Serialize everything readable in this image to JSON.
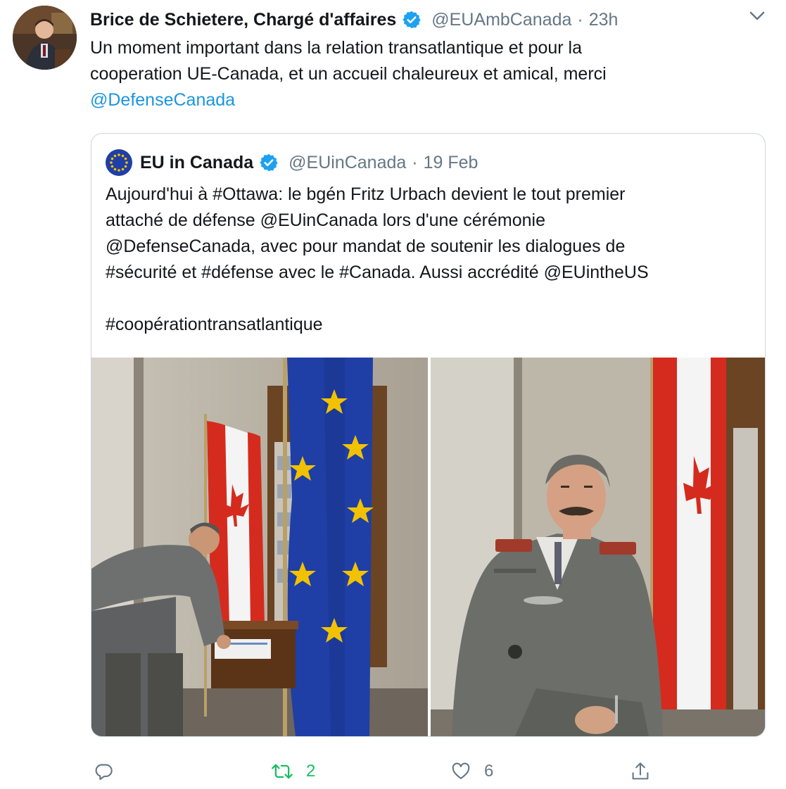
{
  "tweet": {
    "author_name": "Brice de Schietere, Chargé d'affaires",
    "handle": "@EUAmbCanada",
    "separator": "·",
    "time": "23h",
    "text_lines": [
      "Un moment important dans la relation transatlantique et pour la",
      "cooperation UE-Canada, et un accueil chaleureux et amical, merci"
    ],
    "mention": "@DefenseCanada"
  },
  "quote": {
    "author_name": "EU in Canada",
    "handle": "@EUinCanada",
    "separator": "·",
    "date": "19 Feb",
    "text_lines": [
      "Aujourd'hui à #Ottawa: le bgén Fritz Urbach devient le tout premier",
      "attaché de défense @EUinCanada lors d'une cérémonie",
      "@DefenseCanada, avec pour mandat de soutenir les dialogues de",
      "#sécurité et #défense avec le #Canada. Aussi accrédité @EUintheUS",
      "",
      "#coopérationtransatlantique"
    ]
  },
  "actions": {
    "reply_count": "",
    "retweet_count": "2",
    "like_count": "6"
  },
  "icons": {
    "verified": "verified-badge-icon",
    "caret": "chevron-down-icon",
    "reply": "reply-icon",
    "retweet": "retweet-icon",
    "like": "heart-icon",
    "share": "share-icon"
  },
  "colors": {
    "link": "#1b95e0",
    "secondary_text": "#657786",
    "retweet_green": "#17bf63",
    "border": "#ccd6dd",
    "eu_blue": "#1f3fa6",
    "eu_star": "#f2c200",
    "canada_red": "#d52b1e"
  }
}
